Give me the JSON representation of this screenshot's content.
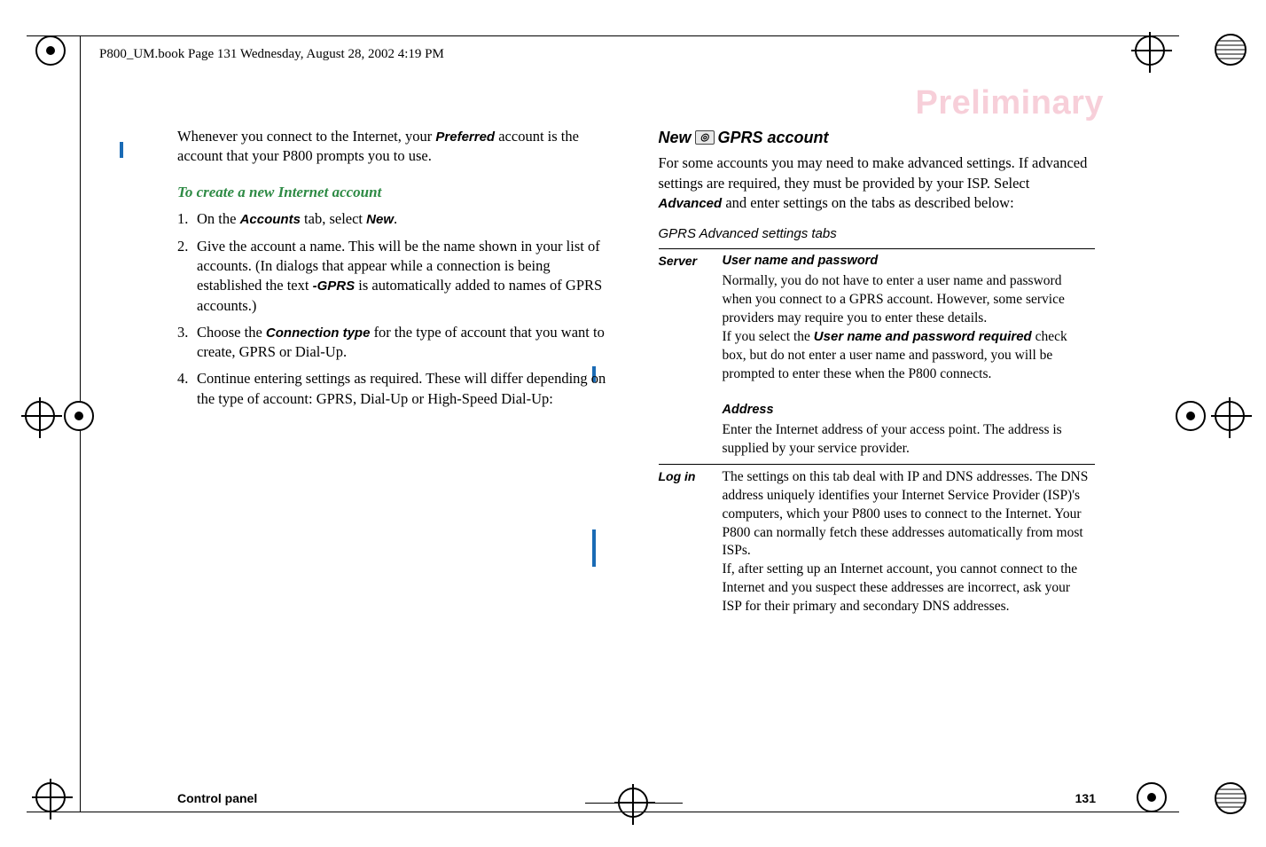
{
  "header": "P800_UM.book  Page 131  Wednesday, August 28, 2002  4:19 PM",
  "watermark": "Preliminary",
  "left_col": {
    "intro_before": "Whenever you connect to the Internet, your ",
    "intro_bold": "Preferred",
    "intro_after": " account is the account that your P800 prompts you to use.",
    "subhead": "To create a new Internet account",
    "step1_a": "On the ",
    "step1_tab": "Accounts",
    "step1_b": " tab, select ",
    "step1_new": "New",
    "step1_c": ".",
    "step2_a": "Give the account a name. This will be the name shown in your list of accounts. (In dialogs that appear while a connection is being established the text ",
    "step2_gprs": "-GPRS",
    "step2_b": " is automatically added to names of GPRS accounts.)",
    "step3_a": "Choose the ",
    "step3_ct": "Connection type",
    "step3_b": " for the type of account that you want to create, GPRS or Dial-Up.",
    "step4": "Continue entering settings as required. These will differ depending on the type of account: GPRS, Dial-Up or High-Speed Dial-Up:"
  },
  "right_col": {
    "head_new": "New",
    "head_rest": " GPRS account",
    "para_a": "For some accounts you may need to make advanced settings. If advanced settings are required, they must be provided by your ISP. Select ",
    "para_bold": "Advanced",
    "para_b": "  and enter settings on the tabs as described below:",
    "table_caption": "GPRS Advanced settings tabs",
    "row_server_label": "Server",
    "row_server": {
      "h1": "User name and password",
      "p1": "Normally, you do not have to enter a user name and password when you connect to a GPRS account. However, some service providers may require you to enter these details.",
      "p2a": "If you select the ",
      "p2bold": "User name and password required",
      "p2b": " check box, but do not enter a user name and password, you will be prompted to enter these when the P800 connects.",
      "h2": "Address",
      "p3": "Enter the Internet address of your access point. The address is supplied by your service provider."
    },
    "row_login_label": "Log in",
    "row_login": {
      "p1": "The settings on this tab deal with IP and DNS addresses. The DNS address uniquely identifies your Internet Service Provider (ISP)'s computers, which your P800 uses to connect to the Internet. Your P800 can normally fetch these addresses automatically from most ISPs.",
      "p2": "If, after setting up an Internet account, you cannot connect to the Internet and you suspect these addresses are incorrect, ask your ISP for their primary and secondary DNS addresses."
    }
  },
  "footer": {
    "left": "Control panel",
    "right": "131"
  }
}
